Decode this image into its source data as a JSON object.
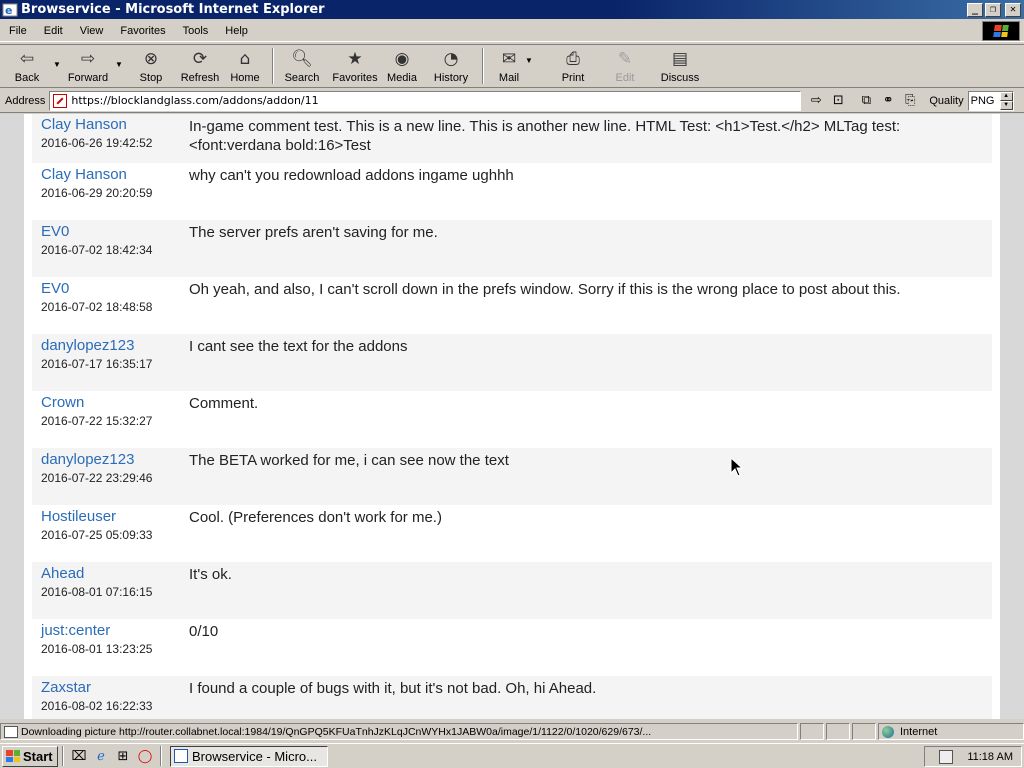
{
  "window": {
    "title": "Browservice - Microsoft Internet Explorer",
    "min_label": "_",
    "max_label": "❐",
    "close_label": "✕"
  },
  "menu": [
    "File",
    "Edit",
    "View",
    "Favorites",
    "Tools",
    "Help"
  ],
  "toolbar": {
    "back": "Back",
    "forward": "Forward",
    "stop": "Stop",
    "refresh": "Refresh",
    "home": "Home",
    "search": "Search",
    "favorites": "Favorites",
    "media": "Media",
    "history": "History",
    "mail": "Mail",
    "print": "Print",
    "edit": "Edit",
    "discuss": "Discuss"
  },
  "address": {
    "label": "Address",
    "url": "https://blocklandglass.com/addons/addon/11",
    "quality_label": "Quality",
    "quality_value": "PNG"
  },
  "comments": [
    {
      "author": "Clay Hanson",
      "date": "2016-06-26 19:42:52",
      "text": "In-game comment test. This is a new line. This is another new line. HTML Test: <h1>Test.</h2> MLTag test: <font:verdana bold:16>Test"
    },
    {
      "author": "Clay Hanson",
      "date": "2016-06-29 20:20:59",
      "text": "why can't you redownload addons ingame ughhh"
    },
    {
      "author": "EV0",
      "date": "2016-07-02 18:42:34",
      "text": "The server prefs aren't saving for me."
    },
    {
      "author": "EV0",
      "date": "2016-07-02 18:48:58",
      "text": "Oh yeah, and also, I can't scroll down in the prefs window. Sorry if this is the wrong place to post about this."
    },
    {
      "author": "danylopez123",
      "date": "2016-07-17 16:35:17",
      "text": "I cant see the text for the addons"
    },
    {
      "author": "Crown",
      "date": "2016-07-22 15:32:27",
      "text": "Comment."
    },
    {
      "author": "danylopez123",
      "date": "2016-07-22 23:29:46",
      "text": "The BETA worked for me, i can see now the text"
    },
    {
      "author": "Hostileuser",
      "date": "2016-07-25 05:09:33",
      "text": "Cool. (Preferences don't work for me.)"
    },
    {
      "author": "Ahead",
      "date": "2016-08-01 07:16:15",
      "text": "It's ok."
    },
    {
      "author": "just:center",
      "date": "2016-08-01 13:23:25",
      "text": "0/10"
    },
    {
      "author": "Zaxstar",
      "date": "2016-08-02 16:22:33",
      "text": "I found a couple of bugs with it, but it's not bad. Oh, hi Ahead."
    }
  ],
  "status": {
    "text": "Downloading picture http://router.collabnet.local:1984/19/QnGPQ5KFUaTnhJzKLqJCnWYHx1JABW0a/image/1/1122/0/1020/629/673/...",
    "zone": "Internet"
  },
  "taskbar": {
    "start": "Start",
    "task_title": "Browservice - Micro...",
    "clock": "11:18 AM"
  }
}
